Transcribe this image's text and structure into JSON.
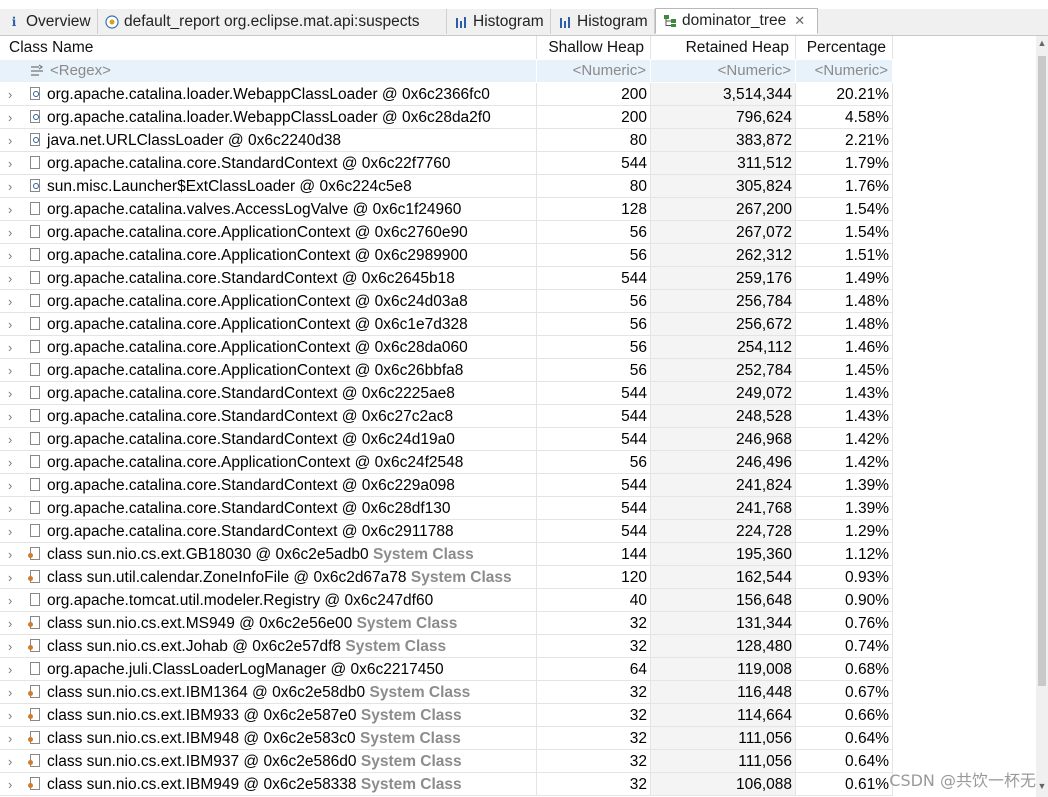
{
  "tabs": [
    {
      "label": "Overview",
      "icon": "info-icon"
    },
    {
      "label": "default_report  org.eclipse.mat.api:suspects",
      "icon": "report-icon"
    },
    {
      "label": "Histogram",
      "icon": "histogram-icon"
    },
    {
      "label": "Histogram",
      "icon": "histogram-icon"
    },
    {
      "label": "dominator_tree",
      "icon": "tree-icon",
      "active": true,
      "close": "✕"
    }
  ],
  "columns": {
    "name": "Class Name",
    "shallow": "Shallow Heap",
    "retained": "Retained Heap",
    "percentage": "Percentage"
  },
  "filters": {
    "name": "<Regex>",
    "shallow": "<Numeric>",
    "retained": "<Numeric>",
    "percentage": "<Numeric>"
  },
  "rows": [
    {
      "name": "org.apache.catalina.loader.WebappClassLoader @ 0x6c2366fc0",
      "tag": "",
      "shallow": "200",
      "retained": "3,514,344",
      "pct": "20.21%",
      "icon": "loader"
    },
    {
      "name": "org.apache.catalina.loader.WebappClassLoader @ 0x6c28da2f0",
      "tag": "",
      "shallow": "200",
      "retained": "796,624",
      "pct": "4.58%",
      "icon": "loader"
    },
    {
      "name": "java.net.URLClassLoader @ 0x6c2240d38",
      "tag": "",
      "shallow": "80",
      "retained": "383,872",
      "pct": "2.21%",
      "icon": "loader"
    },
    {
      "name": "org.apache.catalina.core.StandardContext @ 0x6c22f7760",
      "tag": "",
      "shallow": "544",
      "retained": "311,512",
      "pct": "1.79%",
      "icon": "object"
    },
    {
      "name": "sun.misc.Launcher$ExtClassLoader @ 0x6c224c5e8",
      "tag": "",
      "shallow": "80",
      "retained": "305,824",
      "pct": "1.76%",
      "icon": "loader"
    },
    {
      "name": "org.apache.catalina.valves.AccessLogValve @ 0x6c1f24960",
      "tag": "",
      "shallow": "128",
      "retained": "267,200",
      "pct": "1.54%",
      "icon": "object"
    },
    {
      "name": "org.apache.catalina.core.ApplicationContext @ 0x6c2760e90",
      "tag": "",
      "shallow": "56",
      "retained": "267,072",
      "pct": "1.54%",
      "icon": "object"
    },
    {
      "name": "org.apache.catalina.core.ApplicationContext @ 0x6c2989900",
      "tag": "",
      "shallow": "56",
      "retained": "262,312",
      "pct": "1.51%",
      "icon": "object"
    },
    {
      "name": "org.apache.catalina.core.StandardContext @ 0x6c2645b18",
      "tag": "",
      "shallow": "544",
      "retained": "259,176",
      "pct": "1.49%",
      "icon": "object"
    },
    {
      "name": "org.apache.catalina.core.ApplicationContext @ 0x6c24d03a8",
      "tag": "",
      "shallow": "56",
      "retained": "256,784",
      "pct": "1.48%",
      "icon": "object"
    },
    {
      "name": "org.apache.catalina.core.ApplicationContext @ 0x6c1e7d328",
      "tag": "",
      "shallow": "56",
      "retained": "256,672",
      "pct": "1.48%",
      "icon": "object"
    },
    {
      "name": "org.apache.catalina.core.ApplicationContext @ 0x6c28da060",
      "tag": "",
      "shallow": "56",
      "retained": "254,112",
      "pct": "1.46%",
      "icon": "object"
    },
    {
      "name": "org.apache.catalina.core.ApplicationContext @ 0x6c26bbfa8",
      "tag": "",
      "shallow": "56",
      "retained": "252,784",
      "pct": "1.45%",
      "icon": "object"
    },
    {
      "name": "org.apache.catalina.core.StandardContext @ 0x6c2225ae8",
      "tag": "",
      "shallow": "544",
      "retained": "249,072",
      "pct": "1.43%",
      "icon": "object"
    },
    {
      "name": "org.apache.catalina.core.StandardContext @ 0x6c27c2ac8",
      "tag": "",
      "shallow": "544",
      "retained": "248,528",
      "pct": "1.43%",
      "icon": "object"
    },
    {
      "name": "org.apache.catalina.core.StandardContext @ 0x6c24d19a0",
      "tag": "",
      "shallow": "544",
      "retained": "246,968",
      "pct": "1.42%",
      "icon": "object"
    },
    {
      "name": "org.apache.catalina.core.ApplicationContext @ 0x6c24f2548",
      "tag": "",
      "shallow": "56",
      "retained": "246,496",
      "pct": "1.42%",
      "icon": "object"
    },
    {
      "name": "org.apache.catalina.core.StandardContext @ 0x6c229a098",
      "tag": "",
      "shallow": "544",
      "retained": "241,824",
      "pct": "1.39%",
      "icon": "object"
    },
    {
      "name": "org.apache.catalina.core.StandardContext @ 0x6c28df130",
      "tag": "",
      "shallow": "544",
      "retained": "241,768",
      "pct": "1.39%",
      "icon": "object"
    },
    {
      "name": "org.apache.catalina.core.StandardContext @ 0x6c2911788",
      "tag": "",
      "shallow": "544",
      "retained": "224,728",
      "pct": "1.29%",
      "icon": "object"
    },
    {
      "name": "class sun.nio.cs.ext.GB18030 @ 0x6c2e5adb0",
      "tag": "System Class",
      "shallow": "144",
      "retained": "195,360",
      "pct": "1.12%",
      "icon": "sysclass"
    },
    {
      "name": "class sun.util.calendar.ZoneInfoFile @ 0x6c2d67a78",
      "tag": "System Class",
      "shallow": "120",
      "retained": "162,544",
      "pct": "0.93%",
      "icon": "sysclass"
    },
    {
      "name": "org.apache.tomcat.util.modeler.Registry @ 0x6c247df60",
      "tag": "",
      "shallow": "40",
      "retained": "156,648",
      "pct": "0.90%",
      "icon": "object"
    },
    {
      "name": "class sun.nio.cs.ext.MS949 @ 0x6c2e56e00",
      "tag": "System Class",
      "shallow": "32",
      "retained": "131,344",
      "pct": "0.76%",
      "icon": "sysclass"
    },
    {
      "name": "class sun.nio.cs.ext.Johab @ 0x6c2e57df8",
      "tag": "System Class",
      "shallow": "32",
      "retained": "128,480",
      "pct": "0.74%",
      "icon": "sysclass"
    },
    {
      "name": "org.apache.juli.ClassLoaderLogManager @ 0x6c2217450",
      "tag": "",
      "shallow": "64",
      "retained": "119,008",
      "pct": "0.68%",
      "icon": "object"
    },
    {
      "name": "class sun.nio.cs.ext.IBM1364 @ 0x6c2e58db0",
      "tag": "System Class",
      "shallow": "32",
      "retained": "116,448",
      "pct": "0.67%",
      "icon": "sysclass"
    },
    {
      "name": "class sun.nio.cs.ext.IBM933 @ 0x6c2e587e0",
      "tag": "System Class",
      "shallow": "32",
      "retained": "114,664",
      "pct": "0.66%",
      "icon": "sysclass"
    },
    {
      "name": "class sun.nio.cs.ext.IBM948 @ 0x6c2e583c0",
      "tag": "System Class",
      "shallow": "32",
      "retained": "111,056",
      "pct": "0.64%",
      "icon": "sysclass"
    },
    {
      "name": "class sun.nio.cs.ext.IBM937 @ 0x6c2e586d0",
      "tag": "System Class",
      "shallow": "32",
      "retained": "111,056",
      "pct": "0.64%",
      "icon": "sysclass"
    },
    {
      "name": "class sun.nio.cs.ext.IBM949 @ 0x6c2e58338",
      "tag": "System Class",
      "shallow": "32",
      "retained": "106,088",
      "pct": "0.61%",
      "icon": "sysclass"
    }
  ],
  "watermark": "CSDN @共饮一杯无"
}
